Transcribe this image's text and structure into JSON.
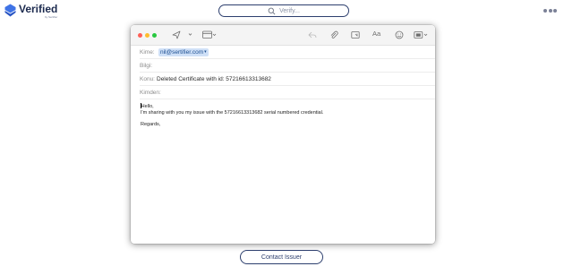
{
  "app": {
    "brand": "Verified",
    "brand_sub": "by Sertifier",
    "accent": "#2d3f6e",
    "logo_color": "#3f73e6"
  },
  "search": {
    "placeholder": "Verify..."
  },
  "mail": {
    "fields": {
      "to_label": "Kime:",
      "to_chip": "nil@sertifier.com",
      "cc_label": "Bilgi:",
      "cc_value": "",
      "subject_label": "Konu:",
      "subject_value": "Deleted Certificate with id: 57216613313682",
      "from_label": "Kimden:",
      "from_value": ""
    },
    "body": {
      "greeting": "Hello,",
      "line1": "I'm sharing with you my issue with the 57216613313682 serial numbered credential.",
      "closing": "Regards,"
    },
    "toolbar_icons": [
      "send-icon",
      "send-options-icon",
      "header-fields-icon",
      "reply-icon",
      "attachment-icon",
      "photo-browser-icon",
      "format-text-icon",
      "emoji-icon",
      "insert-media-icon"
    ],
    "format_label": "Aa"
  },
  "contact_button": {
    "label": "Contact Issuer"
  }
}
